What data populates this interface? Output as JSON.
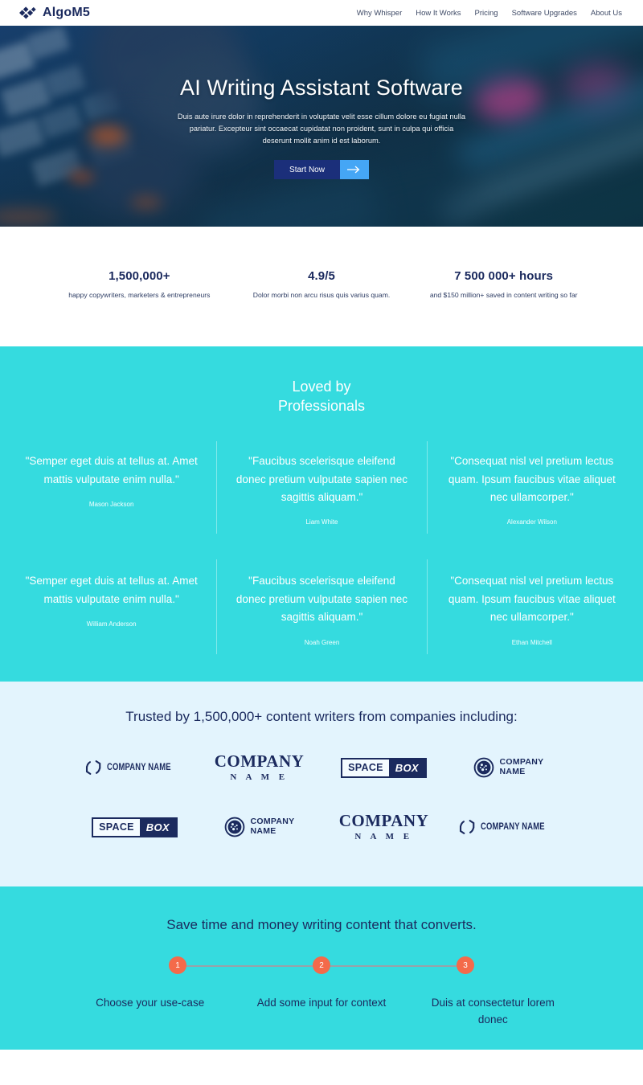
{
  "header": {
    "brand": "AlgoM5",
    "logo_icon": "diamond-cluster-icon",
    "nav": [
      {
        "label": "Why Whisper"
      },
      {
        "label": "How It Works"
      },
      {
        "label": "Pricing"
      },
      {
        "label": "Software Upgrades"
      },
      {
        "label": "About Us"
      }
    ]
  },
  "hero": {
    "title": "AI Writing Assistant Software",
    "subtitle": "Duis aute irure dolor in reprehenderit in voluptate velit esse cillum dolore eu fugiat nulla pariatur. Excepteur sint occaecat cupidatat non proident, sunt in culpa qui officia deserunt mollit anim id est laborum.",
    "cta_label": "Start Now",
    "cta_arrow_icon": "arrow-right-icon",
    "cta_color": "#1b2f7a",
    "arrow_color": "#45a6f5"
  },
  "stats": [
    {
      "value": "1,500,000+",
      "label": "happy copywriters, marketers & entrepreneurs"
    },
    {
      "value": "4.9/5",
      "label": "Dolor morbi non arcu risus quis varius quam."
    },
    {
      "value": "7 500 000+ hours",
      "label": "and $150 million+ saved in content writing so far"
    }
  ],
  "testimonials": {
    "heading": "Loved by\nProfessionals",
    "bg_color": "#35dbdf",
    "items": [
      {
        "quote": "\"Semper eget duis at tellus at. Amet mattis vulputate enim nulla.\"",
        "author": "Mason Jackson"
      },
      {
        "quote": "\"Faucibus scelerisque eleifend donec pretium vulputate sapien nec sagittis aliquam.\"",
        "author": "Liam White"
      },
      {
        "quote": "\"Consequat nisl vel pretium lectus quam. Ipsum faucibus vitae aliquet nec ullamcorper.\"",
        "author": "Alexander Wilson"
      },
      {
        "quote": "\"Semper eget duis at tellus at. Amet mattis vulputate enim nulla.\"",
        "author": "William Anderson"
      },
      {
        "quote": "\"Faucibus scelerisque eleifend donec pretium vulputate sapien nec sagittis aliquam.\"",
        "author": "Noah Green"
      },
      {
        "quote": "\"Consequat nisl vel pretium lectus quam. Ipsum faucibus vitae aliquet nec ullamcorper.\"",
        "author": "Ethan Mitchell"
      }
    ]
  },
  "trusted": {
    "heading": "Trusted by 1,500,000+ content writers from companies including:",
    "bg_color": "#e3f4fd",
    "logos": [
      {
        "type": "hex-swirl",
        "text": "COMPANY NAME"
      },
      {
        "type": "serif-stacked",
        "line1": "COMPANY",
        "line2": "N A M E"
      },
      {
        "type": "space-box",
        "word1": "SPACE",
        "word2": "BOX"
      },
      {
        "type": "globe",
        "line1": "COMPANY",
        "line2": "NAME"
      },
      {
        "type": "space-box",
        "word1": "SPACE",
        "word2": "BOX"
      },
      {
        "type": "globe",
        "line1": "COMPANY",
        "line2": "NAME"
      },
      {
        "type": "serif-stacked",
        "line1": "COMPANY",
        "line2": "N A M E"
      },
      {
        "type": "hex-swirl",
        "text": "COMPANY NAME"
      }
    ]
  },
  "steps": {
    "heading": "Save time and money writing content that converts.",
    "bg_color": "#35dbdf",
    "dot_color": "#f46a4a",
    "items": [
      {
        "number": "1",
        "label": "Choose your use-case"
      },
      {
        "number": "2",
        "label": "Add some input for context"
      },
      {
        "number": "3",
        "label": "Duis at consectetur lorem donec"
      }
    ]
  }
}
